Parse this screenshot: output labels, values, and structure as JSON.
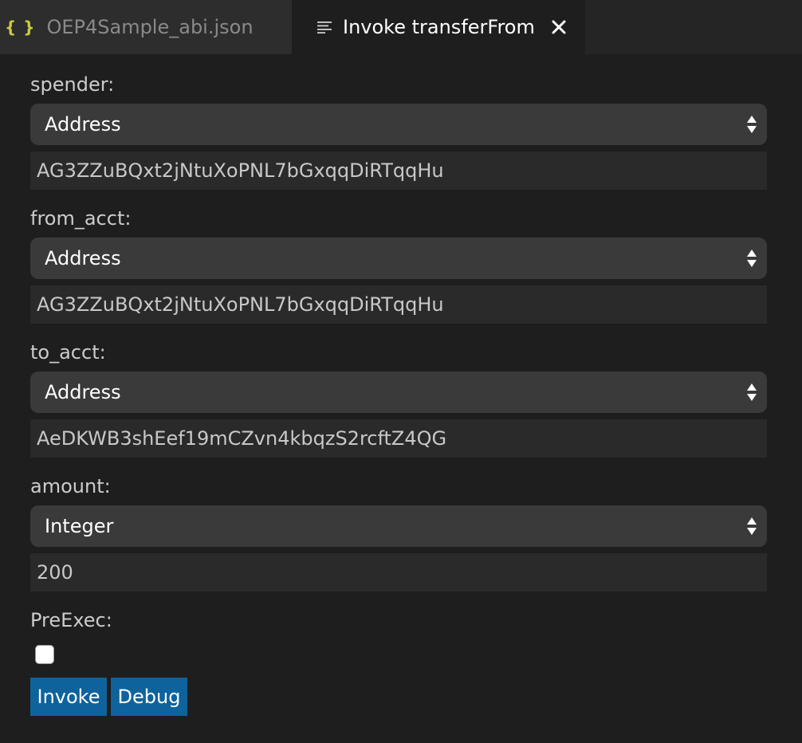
{
  "tabs": [
    {
      "label": "OEP4Sample_abi.json",
      "icon": "json-braces-icon",
      "active": false
    },
    {
      "label": "Invoke transferFrom",
      "icon": "preview-lines-icon",
      "active": true
    }
  ],
  "params": [
    {
      "label": "spender:",
      "type": "Address",
      "value": "AG3ZZuBQxt2jNtuXoPNL7bGxqqDiRTqqHu"
    },
    {
      "label": "from_acct:",
      "type": "Address",
      "value": "AG3ZZuBQxt2jNtuXoPNL7bGxqqDiRTqqHu"
    },
    {
      "label": "to_acct:",
      "type": "Address",
      "value": "AeDKWB3shEef19mCZvn4kbqzS2rcftZ4QG"
    },
    {
      "label": "amount:",
      "type": "Integer",
      "value": "200"
    }
  ],
  "preexec": {
    "label": "PreExec:",
    "checked": false
  },
  "buttons": {
    "invoke": "Invoke",
    "debug": "Debug"
  },
  "colors": {
    "background": "#1e1e1e",
    "tab_inactive": "#2d2d2d",
    "select_bg": "#3a3a3a",
    "input_bg": "#2a2a2a",
    "button_bg": "#0e639c",
    "json_icon": "#cbcb41"
  }
}
